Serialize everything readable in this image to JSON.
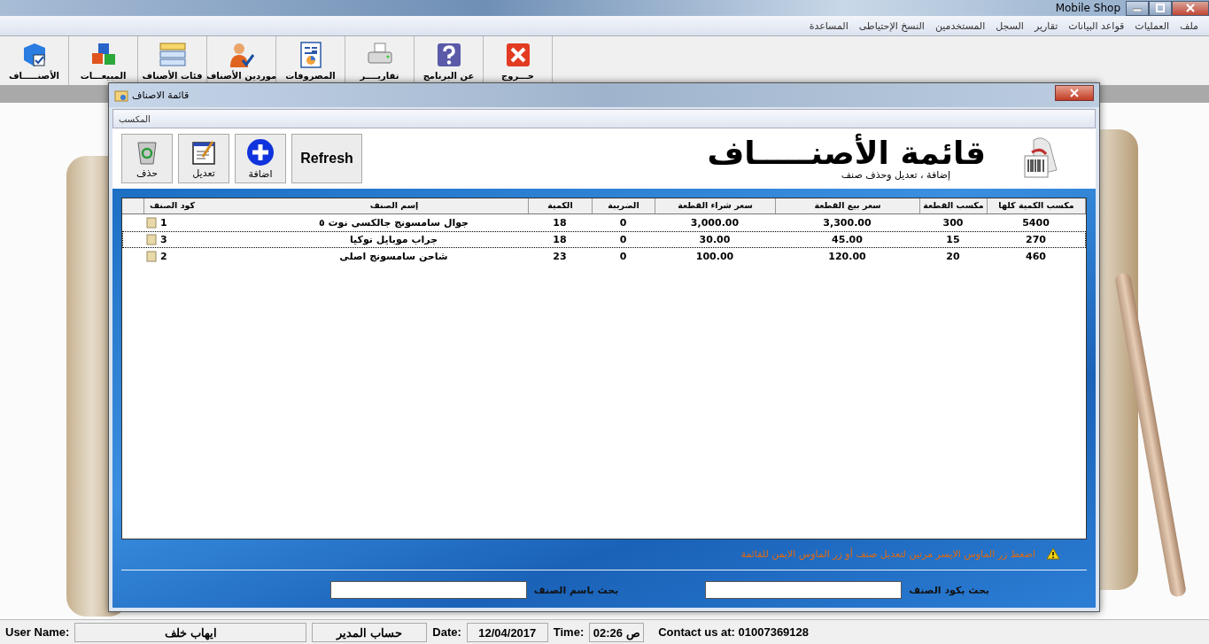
{
  "window": {
    "title": "Mobile Shop"
  },
  "menu": [
    "ملف",
    "العمليات",
    "قواعد البيانات",
    "تقارير",
    "السجل",
    "المستخدمين",
    "النسخ الإحتياطى",
    "المساعدة"
  ],
  "toolbar": [
    {
      "label": "خـــروج",
      "kind": "exit"
    },
    {
      "label": "عن البرنامج",
      "kind": "about"
    },
    {
      "label": "تقاريــــر",
      "kind": "reports"
    },
    {
      "label": "المصروفات",
      "kind": "expenses"
    },
    {
      "label": "موردين الأصناف",
      "kind": "suppliers"
    },
    {
      "label": "فئات الأصناف",
      "kind": "categories"
    },
    {
      "label": "المبيعـــات",
      "kind": "sales"
    },
    {
      "label": "الأصنـــــاف",
      "kind": "items"
    }
  ],
  "dialog": {
    "title": "قائمة الاصناف",
    "menu": [
      "المكسب"
    ],
    "buttons": [
      {
        "label": "Refresh",
        "kind": "refresh"
      },
      {
        "label": "اضافة",
        "kind": "add"
      },
      {
        "label": "تعديل",
        "kind": "edit"
      },
      {
        "label": "حذف",
        "kind": "delete"
      }
    ],
    "heading": "قائمة الأصنـــــاف",
    "subheading": "إضافة ، تعديل وحذف صنف",
    "table": {
      "columns": [
        "مكسب الكمية كلها",
        "مكسب القطعة",
        "سعر بيع القطعة",
        "سعر شراء القطعة",
        "الضريبة",
        "الكمية",
        "إسم الصنف",
        "كود الصنف"
      ],
      "rows": [
        {
          "selected": false,
          "cells": [
            "5400",
            "300",
            "3,300.00",
            "3,000.00",
            "0",
            "18",
            "جوال سامسونج جالكسى نوت ٥",
            "1"
          ]
        },
        {
          "selected": true,
          "cells": [
            "270",
            "15",
            "45.00",
            "30.00",
            "0",
            "18",
            "جراب موبايل نوكيا",
            "3"
          ]
        },
        {
          "selected": false,
          "cells": [
            "460",
            "20",
            "120.00",
            "100.00",
            "0",
            "23",
            "شاحن سامسونج اصلى",
            "2"
          ]
        }
      ]
    },
    "hint": "اضغط زر الماوس الايسر مرتين لتعديل صنف أو زر الماوس الايمن للقائمة",
    "search_code": {
      "label": "بحث بكود الصنف"
    },
    "search_name": {
      "label": "بحث باسم الصنف"
    }
  },
  "status_bar": {
    "user_label": "User Name:",
    "user": "ايهاب خلف",
    "role": "حساب المدير",
    "date_label": "Date:",
    "date": "12/04/2017",
    "time_label": "Time:",
    "time": "02:26 ص",
    "contact": "Contact us at: 01007369128"
  }
}
